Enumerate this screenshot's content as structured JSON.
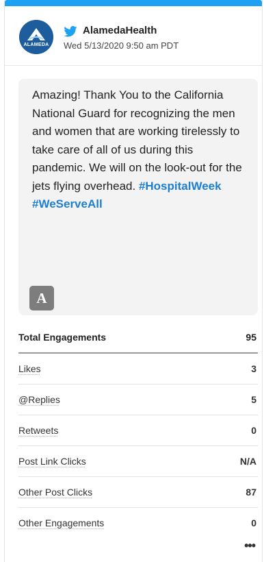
{
  "header": {
    "logo_text": "ALAMEDA",
    "account": "AlamedaHealth",
    "datetime": "Wed 5/13/2020 9:50 am PDT"
  },
  "post": {
    "text": "Amazing! Thank You to the California National Guard for recognizing the men and women that are working tirelessly to take care of all of us during this pandemic. We will on the look-out for the jets flying overhead.",
    "hashtags": "#HospitalWeek #WeServeAll",
    "badge": "A"
  },
  "metrics": {
    "total": {
      "label": "Total Engagements",
      "value": "95"
    },
    "rows": [
      {
        "label": "Likes",
        "value": "3"
      },
      {
        "label": "@Replies",
        "value": "5"
      },
      {
        "label": "Retweets",
        "value": "0"
      },
      {
        "label": "Post Link Clicks",
        "value": "N/A"
      },
      {
        "label": "Other Post Clicks",
        "value": "87"
      },
      {
        "label": "Other Engagements",
        "value": "0"
      }
    ]
  },
  "more_label": "•••",
  "colors": {
    "accent": "#1da1f2",
    "hashtag": "#1d7fd1",
    "avatar": "#1d5d9e"
  }
}
